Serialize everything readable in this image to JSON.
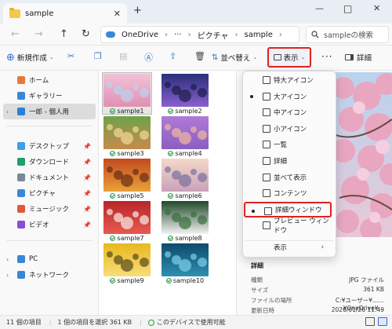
{
  "window": {
    "tab_title": "sample",
    "tab_close": "✕",
    "new_tab": "+",
    "minimize": "—",
    "maximize": "□",
    "close": "✕"
  },
  "address": {
    "back": "←",
    "forward": "→",
    "up": "↑",
    "refresh": "↻",
    "crumbs": [
      "OneDrive",
      "›",
      "···",
      "›",
      "ピクチャ",
      "›",
      "sample",
      "›"
    ],
    "search_placeholder": "sampleの検索"
  },
  "toolbar": {
    "new_label": "新規作成",
    "sort_label": "並べ替え",
    "view_label": "表示",
    "more": "···",
    "details_label": "詳細"
  },
  "sidebar": {
    "items": [
      {
        "label": "ホーム",
        "icon": "home-icon",
        "color": "#e8763a"
      },
      {
        "label": "ギャラリー",
        "icon": "gallery-icon",
        "color": "#3a87d8"
      },
      {
        "label": "一郎 - 個人用",
        "icon": "onedrive-icon",
        "color": "#2b7fd8",
        "selected": true
      },
      {
        "label": "デスクトップ",
        "icon": "desktop-icon",
        "color": "#3aa0e8",
        "pinned": true
      },
      {
        "label": "ダウンロード",
        "icon": "download-icon",
        "color": "#1e9f6a",
        "pinned": true
      },
      {
        "label": "ドキュメント",
        "icon": "documents-icon",
        "color": "#7a8798",
        "pinned": true
      },
      {
        "label": "ピクチャ",
        "icon": "pictures-icon",
        "color": "#3a87d8",
        "pinned": true
      },
      {
        "label": "ミュージック",
        "icon": "music-icon",
        "color": "#e05a3a",
        "pinned": true
      },
      {
        "label": "ビデオ",
        "icon": "video-icon",
        "color": "#8a4fd0",
        "pinned": true
      },
      {
        "label": "PC",
        "icon": "pc-icon",
        "color": "#3a87d8"
      },
      {
        "label": "ネットワーク",
        "icon": "network-icon",
        "color": "#3a87d8"
      }
    ]
  },
  "files": [
    {
      "name": "sample1"
    },
    {
      "name": "sample2"
    },
    {
      "name": "sample3"
    },
    {
      "name": "sample4"
    },
    {
      "name": "sample5"
    },
    {
      "name": "sample6"
    },
    {
      "name": "sample7"
    },
    {
      "name": "sample8"
    },
    {
      "name": "sample9"
    },
    {
      "name": "sample10"
    }
  ],
  "view_menu": {
    "items": [
      {
        "label": "特大アイコン",
        "icon": "extra-large-icons-icon"
      },
      {
        "label": "大アイコン",
        "icon": "large-icons-icon",
        "checked": true
      },
      {
        "label": "中アイコン",
        "icon": "medium-icons-icon"
      },
      {
        "label": "小アイコン",
        "icon": "small-icons-icon"
      },
      {
        "label": "一覧",
        "icon": "list-icon"
      },
      {
        "label": "詳細",
        "icon": "details-icon"
      },
      {
        "label": "並べて表示",
        "icon": "tiles-icon"
      },
      {
        "label": "コンテンツ",
        "icon": "content-icon"
      },
      {
        "label": "詳細ウィンドウ",
        "icon": "details-pane-icon",
        "checked": true
      },
      {
        "label": "プレビュー ウィンドウ",
        "icon": "preview-pane-icon"
      },
      {
        "label": "表示",
        "icon": "",
        "submenu": true
      }
    ],
    "submenu_arrow": "›"
  },
  "details": {
    "section": "詳細",
    "rows": [
      {
        "key": "種類",
        "value": "JPG ファイル"
      },
      {
        "key": "サイズ",
        "value": "361 KB"
      },
      {
        "key": "ファイルの場所",
        "value": "C:¥ユーザー¥……¥OneDrive¥…"
      },
      {
        "key": "更新日時",
        "value": "2026/01/26 11:49"
      }
    ]
  },
  "status": {
    "count": "11 個の項目",
    "selected": "1 個の項目を選択  361 KB",
    "availability": "このデバイスで使用可能"
  },
  "colors": {
    "highlight": "#e02020",
    "accent": "#2a6fd6"
  }
}
